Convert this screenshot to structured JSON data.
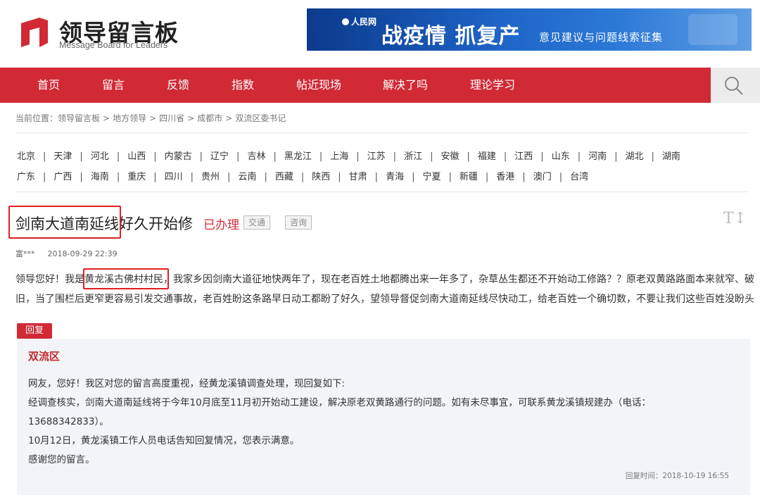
{
  "header": {
    "logo_title": "领导留言板",
    "logo_subtitle": "Message Board for Leaders",
    "banner": {
      "brand": "人民网",
      "headline": "战疫情 抓复产",
      "subline": "意见建议与问题线索征集"
    }
  },
  "nav": {
    "items": [
      "首页",
      "留言",
      "反馈",
      "指数",
      "帖近现场",
      "解决了吗",
      "理论学习"
    ]
  },
  "breadcrumb": {
    "prefix": "当前位置：",
    "items": [
      "领导留言板",
      "地方领导",
      "四川省",
      "成都市",
      "双流区委书记"
    ]
  },
  "provinces": {
    "row1": [
      "北京",
      "天津",
      "河北",
      "山西",
      "内蒙古",
      "辽宁",
      "吉林",
      "黑龙江",
      "上海",
      "江苏",
      "浙江",
      "安徽",
      "福建",
      "江西",
      "山东",
      "河南",
      "湖北",
      "湖南"
    ],
    "row2": [
      "广东",
      "广西",
      "海南",
      "重庆",
      "四川",
      "贵州",
      "云南",
      "西藏",
      "陕西",
      "甘肃",
      "青海",
      "宁夏",
      "新疆",
      "香港",
      "澳门",
      "台湾"
    ]
  },
  "message": {
    "title": "剑南大道南延线好久开始修",
    "status": "已办理",
    "tags": [
      "交通",
      "咨询"
    ],
    "font_toggle": "T↕",
    "author": "富***",
    "datetime": "2018-09-29 22:39",
    "body_line1": "领导您好！我是黄龙溪古佛村村民，我家乡因剑南大道征地快两年了，现在老百姓土地都腾出来一年多了，杂草丛生都还不开始动工修路？？原老双黄路路面本来就窄、破",
    "body_line2": "旧，当了围栏后更窄更容易引发交通事故，老百姓盼这条路早日动工都盼了好久，望领导督促剑南大道南延线尽快动工，给老百姓一个确切数，不要让我们这些百姓没盼头"
  },
  "reply": {
    "label": "回复",
    "org": "双流区",
    "lines": [
      "网友，您好！我区对您的留言高度重视，经黄龙溪镇调查处理，现回复如下:",
      "经调查核实，剑南大道南延线将于今年10月底至11月初开始动工建设，解决原老双黄路通行的问题。如有未尽事宜，可联系黄龙溪镇规建办（电话：",
      "13688342833）。",
      "10月12日，黄龙溪镇工作人员电话告知回复情况，您表示满意。",
      "感谢您的留言。"
    ],
    "time": "回复时间：2018-10-19 16:55"
  },
  "colors": {
    "brand_red": "#d12a35",
    "highlight_red": "#e02020",
    "reply_bg": "#f2f4f7"
  }
}
